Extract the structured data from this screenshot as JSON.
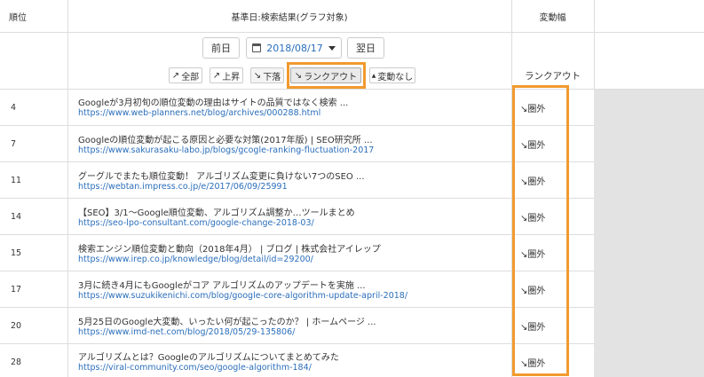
{
  "header": {
    "rank": "順位",
    "base": "基準日:検索結果(グラフ対象)",
    "change": "変動幅"
  },
  "nav": {
    "prev": "前日",
    "date": "2018/08/17",
    "next": "翌日"
  },
  "filters": [
    {
      "icon": "↗",
      "label": "全部"
    },
    {
      "icon": "↗",
      "label": "上昇"
    },
    {
      "icon": "↘",
      "label": "下落"
    },
    {
      "icon": "↘",
      "label": "ランクアウト"
    },
    {
      "icon": "▲",
      "label": "変動なし"
    }
  ],
  "change_header_label": "ランクアウト",
  "highlight_color": "#f19a2f",
  "link_color": "#2a6ebb",
  "rows": [
    {
      "rank": "4",
      "title": "Googleが3月初旬の順位変動の理由はサイトの品質ではなく検索 ...",
      "url": "https://www.web-planners.net/blog/archives/000288.html",
      "change": "↘圏外"
    },
    {
      "rank": "7",
      "title": "Googleの順位変動が起こる原因と必要な対策(2017年版) | SEO研究所 ...",
      "url": "https://www.sakurasaku-labo.jp/blogs/gcogle-ranking-fluctuation-2017",
      "change": "↘圏外"
    },
    {
      "rank": "11",
      "title": "グーグルでまたも順位変動！ アルゴリズム変更に負けない7つのSEO ...",
      "url": "https://webtan.impress.co.jp/e/2017/06/09/25991",
      "change": "↘圏外"
    },
    {
      "rank": "14",
      "title": "【SEO】3/1〜Google順位変動、アルゴリズム調整か…ツールまとめ",
      "url": "https://seo-lpo-consultant.com/google-change-2018-03/",
      "change": "↘圏外"
    },
    {
      "rank": "15",
      "title": "検索エンジン順位変動と動向（2018年4月） | ブログ | 株式会社アイレップ",
      "url": "https://www.irep.co.jp/knowledge/blog/detail/id=29200/",
      "change": "↘圏外"
    },
    {
      "rank": "17",
      "title": "3月に続き4月にもGoogleがコア アルゴリズムのアップデートを実施 ...",
      "url": "https://www.suzukikenichi.com/blog/google-core-algorithm-update-april-2018/",
      "change": "↘圏外"
    },
    {
      "rank": "20",
      "title": "5月25日のGoogle大変動、いったい何が起こったのか？ | ホームページ ...",
      "url": "https://www.imd-net.com/blog/2018/05/29-135806/",
      "change": "↘圏外"
    },
    {
      "rank": "28",
      "title": "アルゴリズムとは？Googleのアルゴリズムについてまとめてみた",
      "url": "https://viral-community.com/seo/google-algorithm-184/",
      "change": "↘圏外"
    }
  ]
}
